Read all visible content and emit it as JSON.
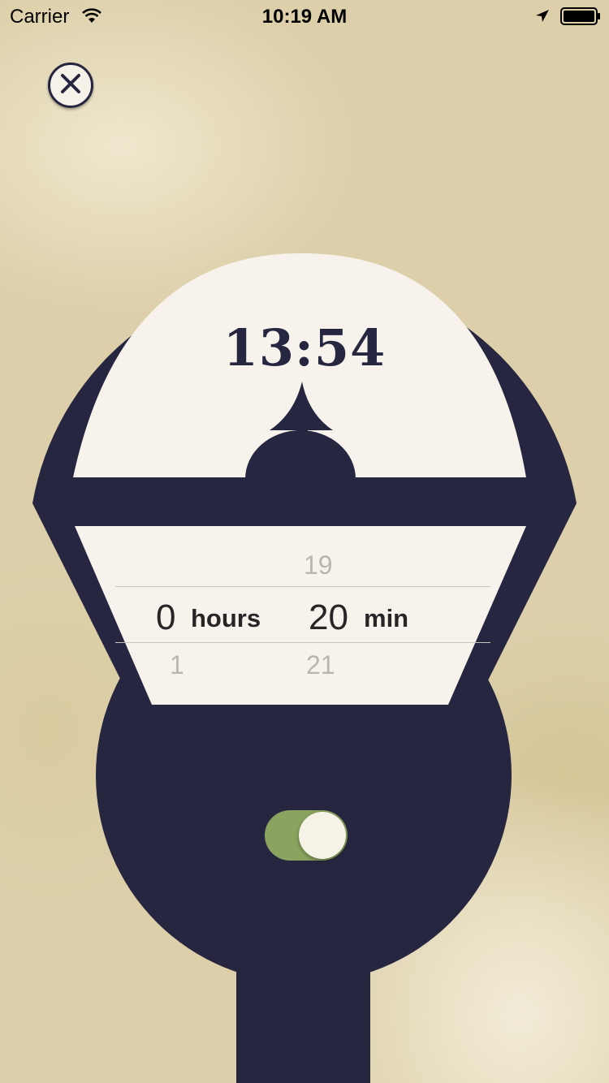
{
  "status_bar": {
    "carrier": "Carrier",
    "time": "10:19 AM",
    "icons": [
      "wifi-icon",
      "location-arrow-icon",
      "battery-icon"
    ]
  },
  "close_button": {
    "icon": "close-icon"
  },
  "meter": {
    "time_remaining": "13:54",
    "colors": {
      "body": "#262640",
      "face": "#f7f3ec",
      "toggle_on": "#8aa35f"
    }
  },
  "picker": {
    "hours_above": "",
    "hours_selected": "0",
    "hours_label": "hours",
    "hours_below": "1",
    "minutes_above": "19",
    "minutes_selected": "20",
    "minutes_label": "min",
    "minutes_below": "21"
  },
  "toggle": {
    "state": "on"
  }
}
